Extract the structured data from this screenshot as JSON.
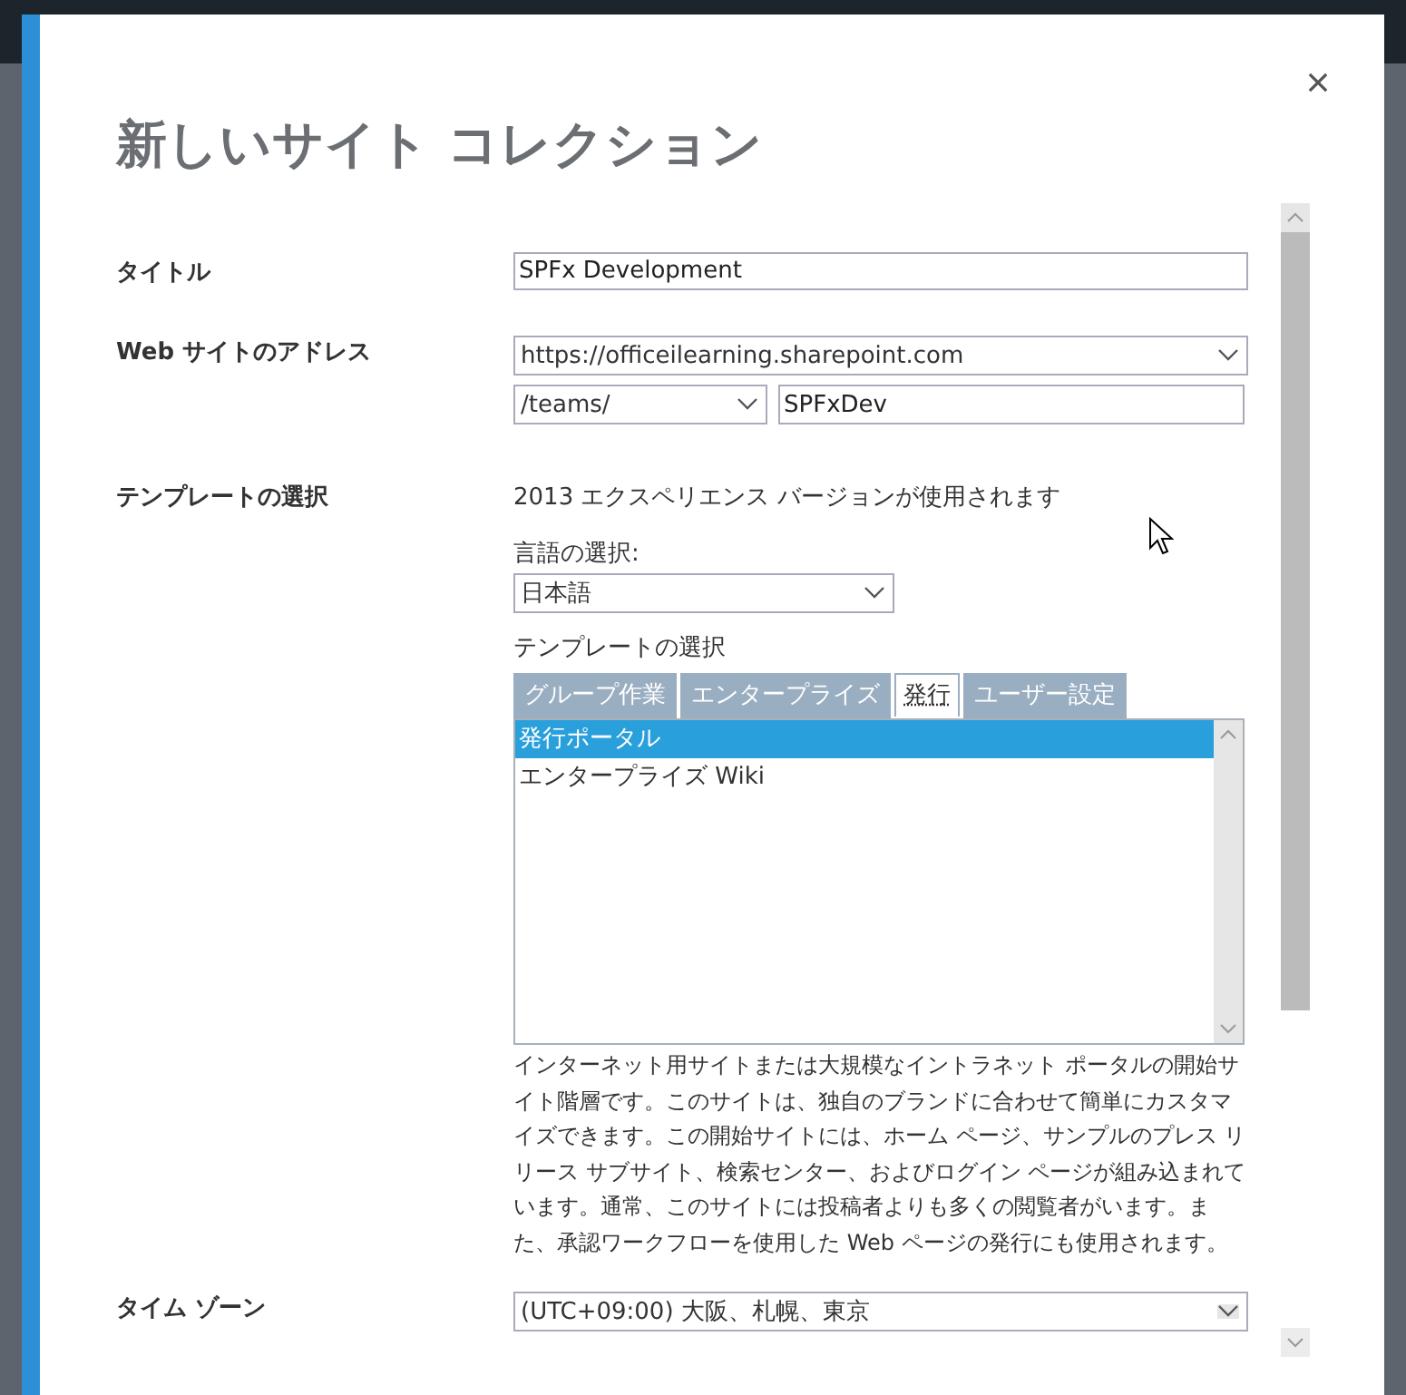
{
  "dialog": {
    "title": "新しいサイト コレクション",
    "title_field": {
      "label": "タイトル",
      "value": "SPFx Development"
    },
    "address": {
      "label": "Web サイトのアドレス",
      "domain": "https://officeilearning.sharepoint.com",
      "path": "/teams/",
      "name": "SPFxDev"
    },
    "template": {
      "label": "テンプレートの選択",
      "version_note": "2013 エクスペリエンス バージョンが使用されます",
      "language_label": "言語の選択:",
      "language": "日本語",
      "picker_label": "テンプレートの選択",
      "tabs": [
        {
          "label": "グループ作業",
          "selected": false
        },
        {
          "label": "エンタープライズ",
          "selected": false
        },
        {
          "label": "発行",
          "selected": true
        },
        {
          "label": "ユーザー設定",
          "selected": false
        }
      ],
      "items": [
        {
          "label": "発行ポータル",
          "selected": true
        },
        {
          "label": "エンタープライズ Wiki",
          "selected": false
        }
      ],
      "description": "インターネット用サイトまたは大規模なイントラネット ポータルの開始サイト階層です。このサイトは、独自のブランドに合わせて簡単にカスタマイズできます。この開始サイトには、ホーム ページ、サンプルのプレス リリース サブサイト、検索センター、およびログイン ページが組み込まれています。通常、このサイトには投稿者よりも多くの閲覧者がいます。また、承認ワークフローを使用した Web ページの発行にも使用されます。"
    },
    "timezone": {
      "label": "タイム ゾーン",
      "value": "(UTC+09:00) 大阪、札幌、東京"
    }
  }
}
